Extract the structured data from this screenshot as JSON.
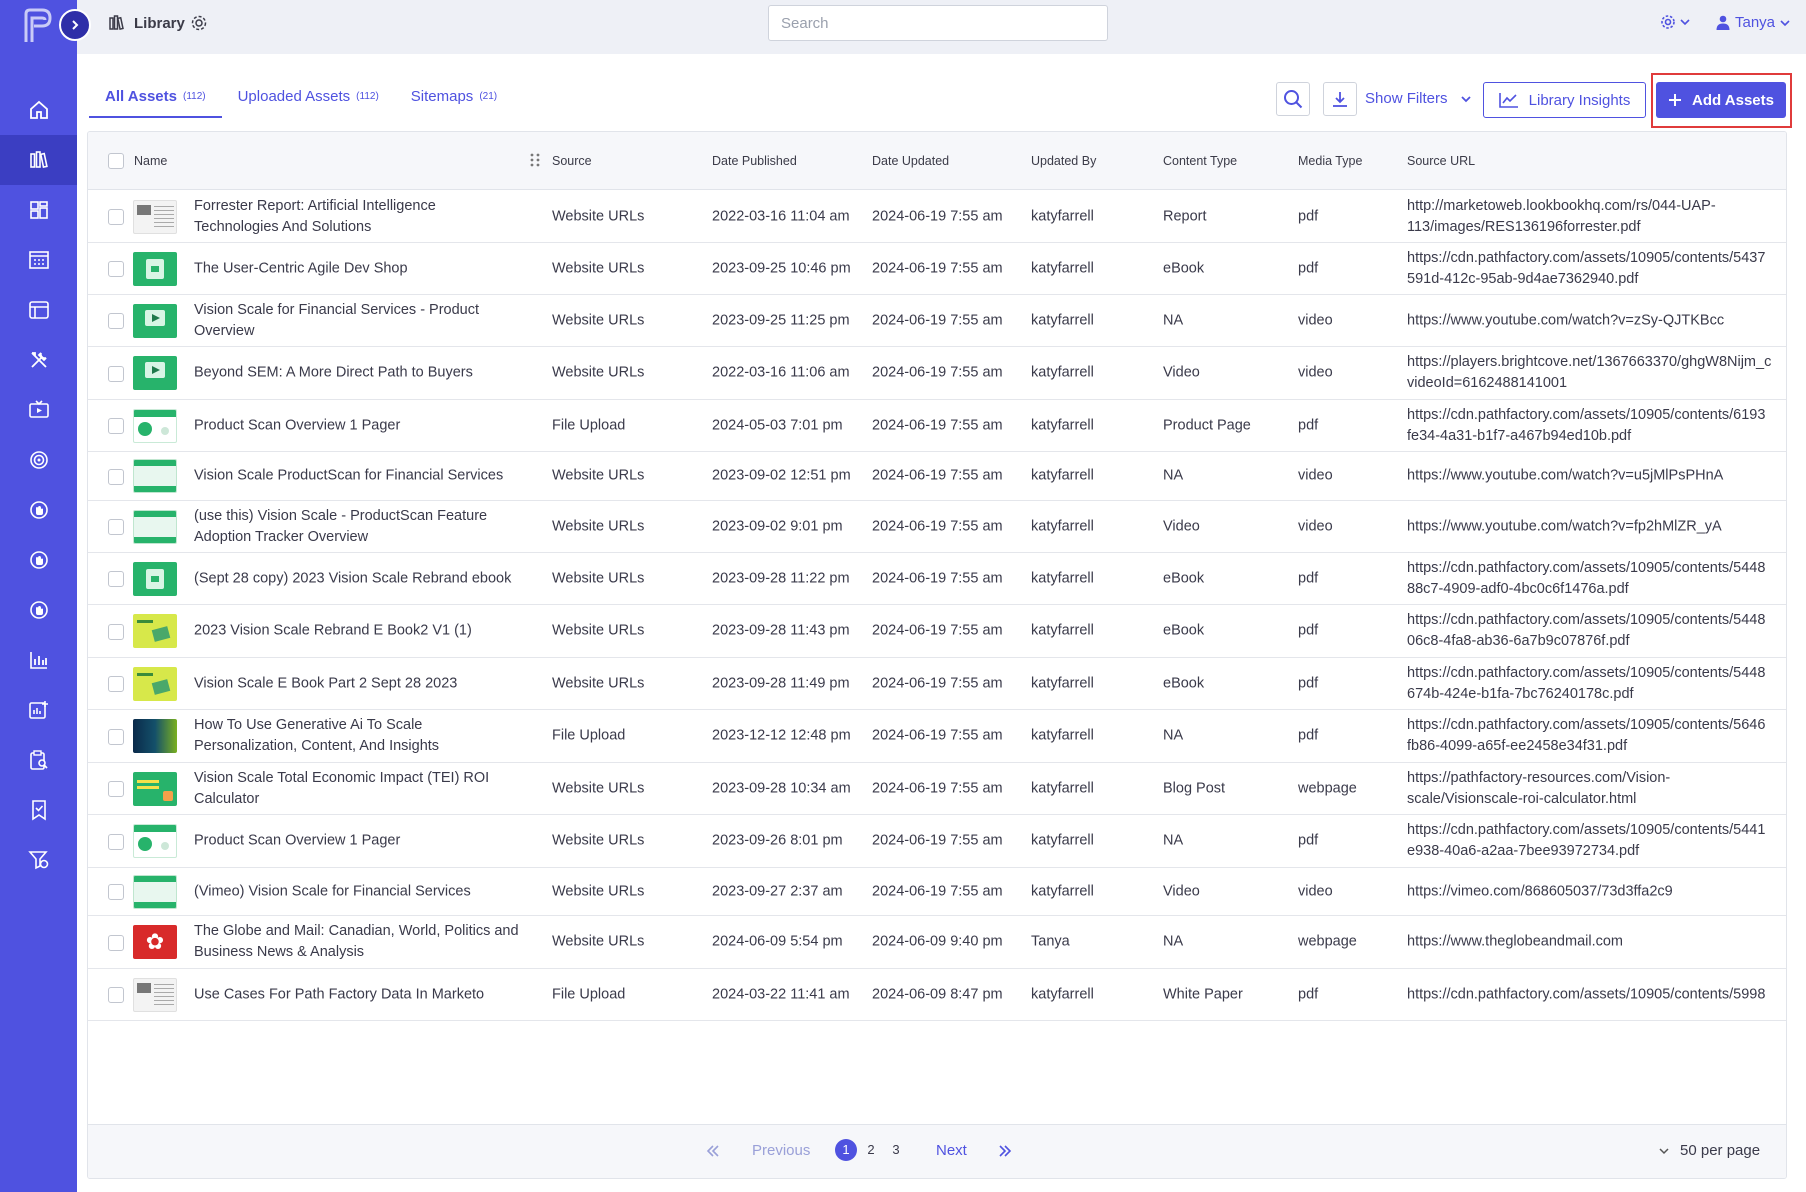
{
  "app": {
    "brand_color": "#4f52e0",
    "highlight_color": "#e03b3b"
  },
  "topbar": {
    "page_title": "Library",
    "search_placeholder": "Search",
    "user_name": "Tanya"
  },
  "sidebar": {
    "items": [
      {
        "icon": "home-icon"
      },
      {
        "icon": "library-icon",
        "active": true
      },
      {
        "icon": "dashboard-icon"
      },
      {
        "icon": "calendar-grid-icon"
      },
      {
        "icon": "browser-window-icon"
      },
      {
        "icon": "tools-icon"
      },
      {
        "icon": "tv-icon"
      },
      {
        "icon": "target-icon"
      },
      {
        "icon": "hand-pointer-icon"
      },
      {
        "icon": "hand-pointer-icon"
      },
      {
        "icon": "hand-pointer-icon"
      },
      {
        "icon": "bar-chart-icon"
      },
      {
        "icon": "chart-plus-icon"
      },
      {
        "icon": "clipboard-search-icon"
      },
      {
        "icon": "bookmark-check-icon"
      },
      {
        "icon": "filter-settings-icon"
      }
    ]
  },
  "tabs": [
    {
      "label": "All Assets",
      "count": "(112)",
      "active": true
    },
    {
      "label": "Uploaded Assets",
      "count": "(112)"
    },
    {
      "label": "Sitemaps",
      "count": "(21)"
    }
  ],
  "toolbar": {
    "show_filters": "Show Filters",
    "library_insights": "Library Insights",
    "add_assets": "Add Assets"
  },
  "table": {
    "columns": {
      "name": "Name",
      "source": "Source",
      "date_published": "Date Published",
      "date_updated": "Date Updated",
      "updated_by": "Updated By",
      "content_type": "Content Type",
      "media_type": "Media Type",
      "source_url": "Source URL"
    },
    "rows": [
      {
        "thumb": "doc",
        "name": "Forrester Report: Artificial Intelligence Technologies And Solutions",
        "source": "Website URLs",
        "published": "2022-03-16 11:04 am",
        "updated": "2024-06-19 7:55 am",
        "by": "katyfarrell",
        "content_type": "Report",
        "media_type": "pdf",
        "url1": "http://marketoweb.lookbookhq.com/rs/044-UAP-",
        "url2": "113/images/RES136196forrester.pdf"
      },
      {
        "thumb": "green",
        "name": "The User-Centric Agile Dev Shop",
        "source": "Website URLs",
        "published": "2023-09-25 10:46 pm",
        "updated": "2024-06-19 7:55 am",
        "by": "katyfarrell",
        "content_type": "eBook",
        "media_type": "pdf",
        "url1": "https://cdn.pathfactory.com/assets/10905/contents/5437",
        "url2": "591d-412c-95ab-9d4ae7362940.pdf"
      },
      {
        "thumb": "video",
        "name": "Vision Scale for Financial Services - Product Overview",
        "source": "Website URLs",
        "published": "2023-09-25 11:25 pm",
        "updated": "2024-06-19 7:55 am",
        "by": "katyfarrell",
        "content_type": "NA",
        "media_type": "video",
        "url1": "https://www.youtube.com/watch?v=zSy-QJTKBcc",
        "url2": ""
      },
      {
        "thumb": "video",
        "name": "Beyond SEM: A More Direct Path to Buyers",
        "source": "Website URLs",
        "published": "2022-03-16 11:06 am",
        "updated": "2024-06-19 7:55 am",
        "by": "katyfarrell",
        "content_type": "Video",
        "media_type": "video",
        "url1": "https://players.brightcove.net/1367663370/ghgW8Nijm_c",
        "url2": "videoId=6162488141001"
      },
      {
        "thumb": "pager",
        "name": "Product Scan Overview 1 Pager",
        "source": "File Upload",
        "published": "2024-05-03 7:01 pm",
        "updated": "2024-06-19 7:55 am",
        "by": "katyfarrell",
        "content_type": "Product Page",
        "media_type": "pdf",
        "url1": "https://cdn.pathfactory.com/assets/10905/contents/6193",
        "url2": "fe34-4a31-b1f7-a467b94ed10b.pdf"
      },
      {
        "thumb": "banner",
        "name": "Vision Scale ProductScan for Financial Services",
        "source": "Website URLs",
        "published": "2023-09-02 12:51 pm",
        "updated": "2024-06-19 7:55 am",
        "by": "katyfarrell",
        "content_type": "NA",
        "media_type": "video",
        "url1": "https://www.youtube.com/watch?v=u5jMlPsPHnA",
        "url2": ""
      },
      {
        "thumb": "banner",
        "name": "(use this) Vision Scale - ProductScan Feature Adoption Tracker Overview",
        "source": "Website URLs",
        "published": "2023-09-02 9:01 pm",
        "updated": "2024-06-19 7:55 am",
        "by": "katyfarrell",
        "content_type": "Video",
        "media_type": "video",
        "url1": "https://www.youtube.com/watch?v=fp2hMlZR_yA",
        "url2": ""
      },
      {
        "thumb": "green",
        "name": "(Sept 28 copy) 2023 Vision Scale Rebrand ebook",
        "source": "Website URLs",
        "published": "2023-09-28 11:22 pm",
        "updated": "2024-06-19 7:55 am",
        "by": "katyfarrell",
        "content_type": "eBook",
        "media_type": "pdf",
        "url1": "https://cdn.pathfactory.com/assets/10905/contents/5448",
        "url2": "88c7-4909-adf0-4bc0c6f1476a.pdf"
      },
      {
        "thumb": "yellow",
        "name": "2023 Vision Scale Rebrand E Book2 V1 (1)",
        "source": "Website URLs",
        "published": "2023-09-28 11:43 pm",
        "updated": "2024-06-19 7:55 am",
        "by": "katyfarrell",
        "content_type": "eBook",
        "media_type": "pdf",
        "url1": "https://cdn.pathfactory.com/assets/10905/contents/5448",
        "url2": "06c8-4fa8-ab36-6a7b9c07876f.pdf"
      },
      {
        "thumb": "yellow",
        "name": "Vision Scale E Book Part 2 Sept 28 2023",
        "source": "Website URLs",
        "published": "2023-09-28 11:49 pm",
        "updated": "2024-06-19 7:55 am",
        "by": "katyfarrell",
        "content_type": "eBook",
        "media_type": "pdf",
        "url1": "https://cdn.pathfactory.com/assets/10905/contents/5448",
        "url2": "674b-424e-b1fa-7bc76240178c.pdf"
      },
      {
        "thumb": "dark",
        "name": "How To Use Generative Ai To Scale Personalization, Content, And Insights",
        "source": "File Upload",
        "published": "2023-12-12 12:48 pm",
        "updated": "2024-06-19 7:55 am",
        "by": "katyfarrell",
        "content_type": "NA",
        "media_type": "pdf",
        "url1": "https://cdn.pathfactory.com/assets/10905/contents/5646",
        "url2": "fb86-4099-a65f-ee2458e34f31.pdf"
      },
      {
        "thumb": "tei",
        "name": "Vision Scale Total Economic Impact (TEI) ROI Calculator",
        "source": "Website URLs",
        "published": "2023-09-28 10:34 am",
        "updated": "2024-06-19 7:55 am",
        "by": "katyfarrell",
        "content_type": "Blog Post",
        "media_type": "webpage",
        "url1": "https://pathfactory-resources.com/Vision-",
        "url2": "scale/Visionscale-roi-calculator.html"
      },
      {
        "thumb": "pager",
        "name": "Product Scan Overview 1 Pager",
        "source": "Website URLs",
        "published": "2023-09-26 8:01 pm",
        "updated": "2024-06-19 7:55 am",
        "by": "katyfarrell",
        "content_type": "NA",
        "media_type": "pdf",
        "url1": "https://cdn.pathfactory.com/assets/10905/contents/5441",
        "url2": "e938-40a6-a2aa-7bee93972734.pdf"
      },
      {
        "thumb": "banner",
        "name": "(Vimeo) Vision Scale for Financial Services",
        "source": "Website URLs",
        "published": "2023-09-27 2:37 am",
        "updated": "2024-06-19 7:55 am",
        "by": "katyfarrell",
        "content_type": "Video",
        "media_type": "video",
        "url1": "https://vimeo.com/868605037/73d3ffa2c9",
        "url2": ""
      },
      {
        "thumb": "globe",
        "name": "The Globe and Mail: Canadian, World, Politics and Business News & Analysis",
        "source": "Website URLs",
        "published": "2024-06-09 5:54 pm",
        "updated": "2024-06-09 9:40 pm",
        "by": "Tanya",
        "content_type": "NA",
        "media_type": "webpage",
        "url1": "https://www.theglobeandmail.com",
        "url2": ""
      },
      {
        "thumb": "doc",
        "name": "Use Cases For Path Factory Data In Marketo",
        "source": "File Upload",
        "published": "2024-03-22 11:41 am",
        "updated": "2024-06-09 8:47 pm",
        "by": "katyfarrell",
        "content_type": "White Paper",
        "media_type": "pdf",
        "url1": "https://cdn.pathfactory.com/assets/10905/contents/5998",
        "url2": ""
      }
    ]
  },
  "pagination": {
    "previous": "Previous",
    "next": "Next",
    "pages": [
      "1",
      "2",
      "3"
    ],
    "current": "1",
    "per_page": "50 per page"
  }
}
